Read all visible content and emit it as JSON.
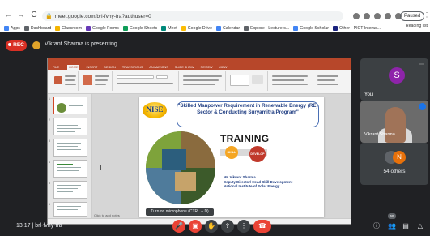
{
  "browser": {
    "url": "meet.google.com/brl-fvhy-fra?authuser=0",
    "paused_label": "Paused",
    "bookmarks": [
      {
        "label": "Apps",
        "color": "#4285f4"
      },
      {
        "label": "Dashboard",
        "color": "#5f6368"
      },
      {
        "label": "Classroom",
        "color": "#f4b400"
      },
      {
        "label": "Google Forms",
        "color": "#673ab7"
      },
      {
        "label": "Google Sheets",
        "color": "#0f9d58"
      },
      {
        "label": "Meet",
        "color": "#00897b"
      },
      {
        "label": "Google Drive",
        "color": "#fbbc04"
      },
      {
        "label": "Calendar",
        "color": "#4285f4"
      },
      {
        "label": "Explore - Lecturers...",
        "color": "#5f6368"
      },
      {
        "label": "Google Scholar",
        "color": "#4285f4"
      },
      {
        "label": "Other - PICT Interac...",
        "color": "#1a237e"
      }
    ],
    "bookmarks_right": "Reading list"
  },
  "meet": {
    "rec_label": "REC",
    "presenting_text": "Vikrant Sharma is presenting",
    "meeting_code": "brl-fvhy-fra",
    "time": "13:17",
    "tooltip": "Turn on microphone (CTRL + D)",
    "participants_badge": "59",
    "tiles": {
      "you_initial": "S",
      "you_label": "You",
      "vikrant_label": "Vikrant Sharma",
      "others_initial": "N",
      "others_label": "54 others"
    },
    "controls": {
      "mic_icon": "mic-off-icon",
      "cam_icon": "camera-off-icon",
      "hand_icon": "raise-hand-icon",
      "present_icon": "present-icon",
      "more_icon": "more-icon",
      "leave_icon": "leave-call-icon",
      "info_icon": "info-icon",
      "people_icon": "people-icon",
      "chat_icon": "chat-icon",
      "activities_icon": "activities-icon"
    }
  },
  "slide": {
    "logo_text": "NISE",
    "title": "\"Skilled Manpower Requirement in Renewable Energy (RE) Sector & Conducting Suryamitra Program\"",
    "training_text": "TRAINING",
    "skill_label": "SKILL",
    "develop_label": "DEVELOP",
    "presenter_name": "Mr. Vikrant Sharma",
    "presenter_role": "Deputy Director/ Head Skill Development",
    "presenter_org": "National Institute of Solar Energy"
  },
  "ppt": {
    "notes_placeholder": "Click to add notes",
    "tabs": [
      "FILE",
      "HOME",
      "INSERT",
      "DESIGN",
      "TRANSITIONS",
      "ANIMATIONS",
      "SLIDE SHOW",
      "REVIEW",
      "VIEW"
    ]
  }
}
